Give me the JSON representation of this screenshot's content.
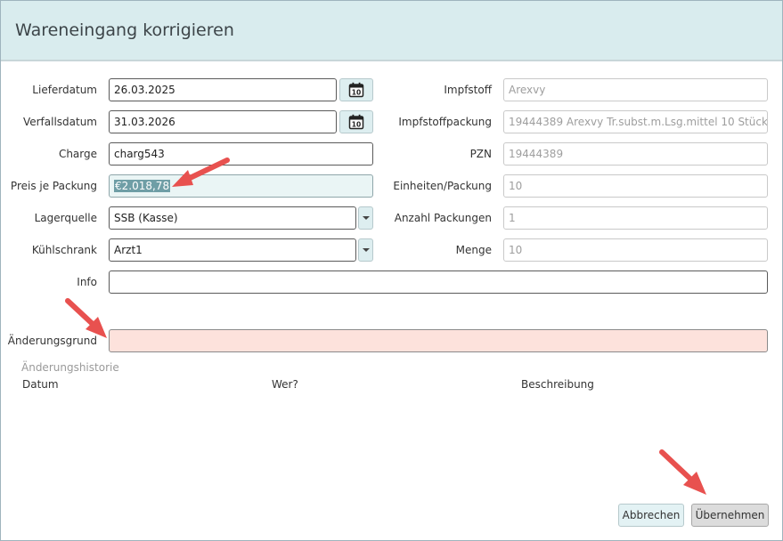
{
  "dialog": {
    "title": "Wareneingang korrigieren"
  },
  "form": {
    "lieferdatum": {
      "label": "Lieferdatum",
      "value": "26.03.2025"
    },
    "verfallsdatum": {
      "label": "Verfallsdatum",
      "value": "31.03.2026"
    },
    "charge": {
      "label": "Charge",
      "value": "charg543"
    },
    "preis": {
      "label": "Preis je Packung",
      "value": "€2.018,78"
    },
    "lagerquelle": {
      "label": "Lagerquelle",
      "value": "SSB (Kasse)"
    },
    "kuehlschrank": {
      "label": "Kühlschrank",
      "value": "Arzt1"
    },
    "info": {
      "label": "Info",
      "value": ""
    },
    "aenderungsgrund": {
      "label": "Änderungsgrund",
      "value": ""
    },
    "impfstoff": {
      "label": "Impfstoff",
      "value": "Arexvy"
    },
    "impfstoffpackung": {
      "label": "Impfstoffpackung",
      "value": "19444389 Arexvy Tr.subst.m.Lsg.mittel 10 Stück *"
    },
    "pzn": {
      "label": "PZN",
      "value": "19444389"
    },
    "einheiten": {
      "label": "Einheiten/Packung",
      "value": "10"
    },
    "anzahl": {
      "label": "Anzahl Packungen",
      "value": "1"
    },
    "menge": {
      "label": "Menge",
      "value": "10"
    }
  },
  "history": {
    "title": "Änderungshistorie",
    "columns": [
      "Datum",
      "Wer?",
      "Beschreibung"
    ]
  },
  "buttons": {
    "cancel": "Abbrechen",
    "ok": "Übernehmen"
  },
  "colors": {
    "header_bg": "#d9ecee",
    "error_bg": "#fde2dc",
    "annotation_arrow": "#e8514f"
  },
  "icons": {
    "calendar_day": "10"
  }
}
